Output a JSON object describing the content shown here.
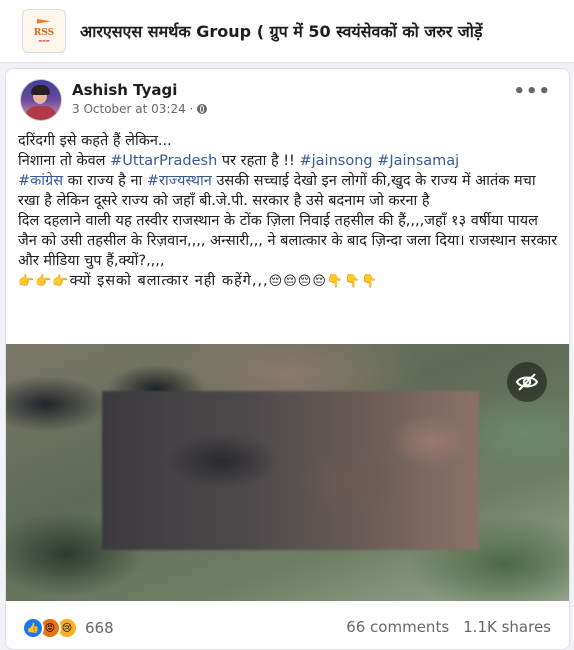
{
  "group": {
    "logo_text": "RSS",
    "title": "आरएसएस समर्थक Group ( ग्रुप में 50 स्वयंसेवकों को जरुर जोड़ें"
  },
  "post": {
    "author": "Ashish Tyagi",
    "timestamp": "3 October at 03:24 ·",
    "audience_icon": "globe-icon",
    "lines": {
      "l1": "दरिंदगी इसे कहते हैं लेकिन...",
      "l2a": "निशाना तो केवल ",
      "l2_tag1": "#UttarPradesh",
      "l2b": "  पर रहता है !! ",
      "l2_tag2": "#jainsong",
      "l2_tag3": "#Jainsamaj",
      "l3_tag1": "#कांग्रेस",
      "l3a": " का राज्य है ना ",
      "l3_tag2": "#राज्यस्थान",
      "l3b": " उसकी सच्चाई देखो इन लोगों की,खुद के राज्य में आतंक मचा रखा है लेकिन दूसरे राज्य को जहाँ बी.जे.पी. सरकार है उसे बदनाम जो करना है",
      "l4": "दिल दहलाने वाली यह तस्वीर राजस्थान के टोंक ज़िला निवाई तहसील की हैं,,,,जहाँ १३ वर्षीया पायल जैन को उसी तहसील के रिज़वान,,,, अन्सारी,,, ने बलात्कार के बाद ज़िन्दा जला दिया। राजस्थान सरकार और मीडिया चुप हैं,क्यों?,,,,",
      "l5a": "👉👉👉",
      "l5b": "क्यों इसको बलात्कार नही कहेंगे,,,",
      "l5c": "😔😔😔😔👇👇👇"
    },
    "image": {
      "sensitive_icon": "eye-off-icon"
    },
    "reactions": {
      "icons": [
        "like-icon",
        "angry-icon",
        "sad-icon"
      ],
      "count": "668"
    },
    "comments": "66 comments",
    "shares": "1.1K shares"
  },
  "colors": {
    "link": "#385898",
    "like": "#1877f2",
    "angry": "#e9710f",
    "sad": "#f7b125"
  }
}
